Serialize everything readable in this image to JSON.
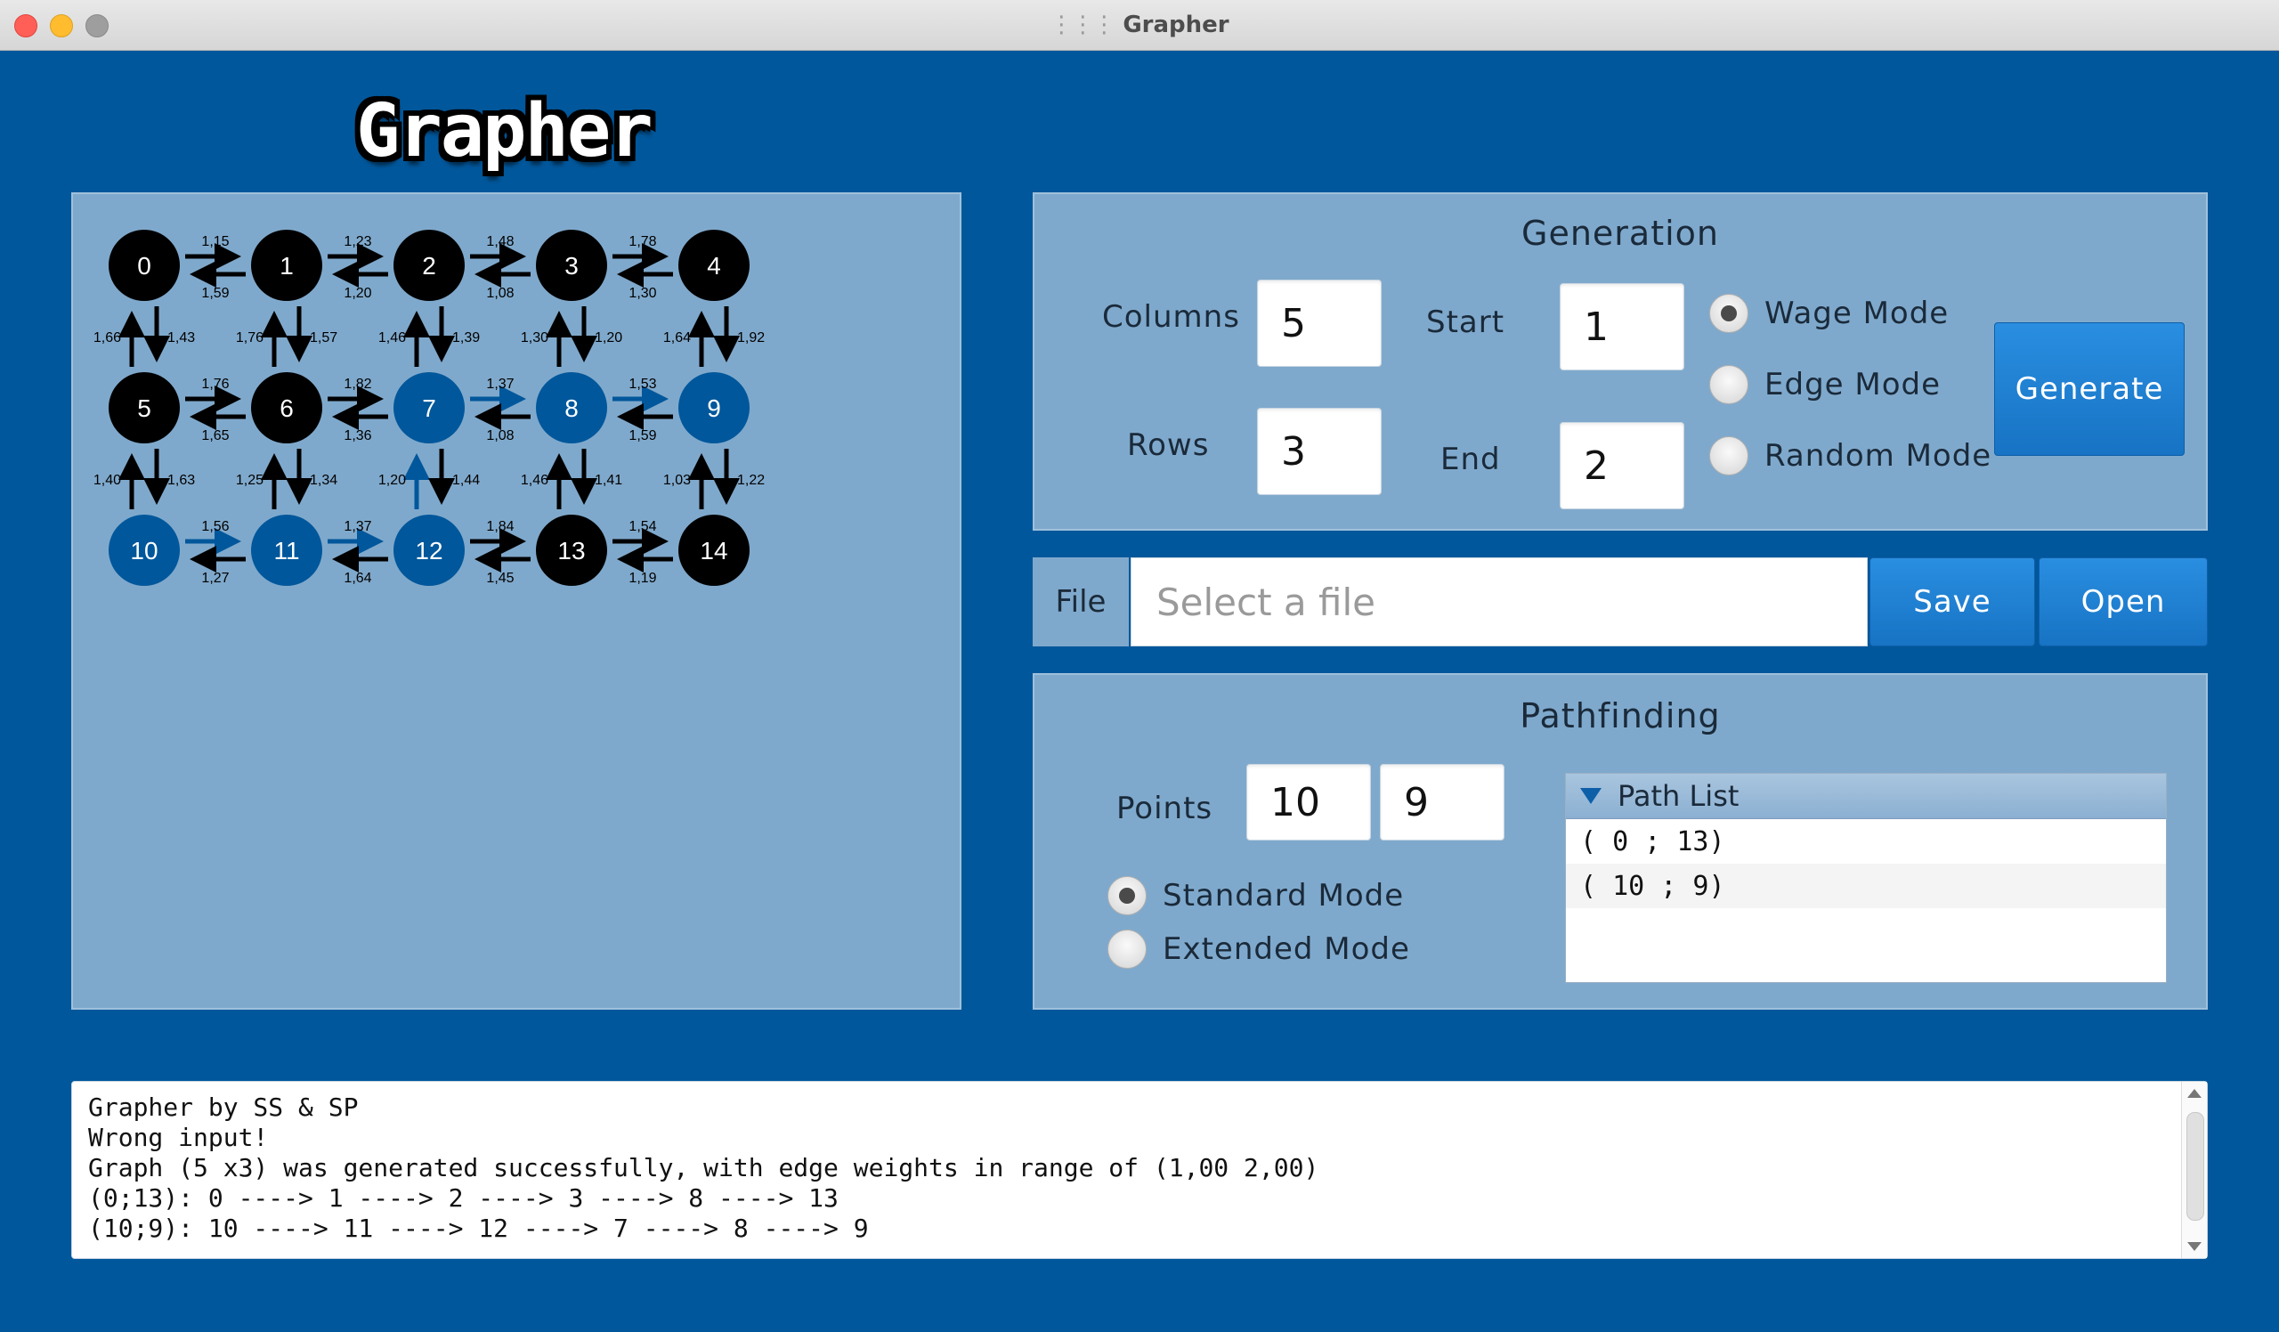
{
  "window": {
    "title": "Grapher"
  },
  "app": {
    "logo_text": "Grapher"
  },
  "graph": {
    "nodes": [
      {
        "id": "0",
        "color": "#000000"
      },
      {
        "id": "1",
        "color": "#000000"
      },
      {
        "id": "2",
        "color": "#000000"
      },
      {
        "id": "3",
        "color": "#000000"
      },
      {
        "id": "4",
        "color": "#000000"
      },
      {
        "id": "5",
        "color": "#000000"
      },
      {
        "id": "6",
        "color": "#000000"
      },
      {
        "id": "7",
        "color": "#01579b"
      },
      {
        "id": "8",
        "color": "#01579b"
      },
      {
        "id": "9",
        "color": "#01579b"
      },
      {
        "id": "10",
        "color": "#01579b"
      },
      {
        "id": "11",
        "color": "#01579b"
      },
      {
        "id": "12",
        "color": "#01579b"
      },
      {
        "id": "13",
        "color": "#000000"
      },
      {
        "id": "14",
        "color": "#000000"
      }
    ],
    "horizontal_edges": [
      {
        "row": 0,
        "col": 0,
        "forward": "1,15",
        "backward": "1,59",
        "forward_highlight": false
      },
      {
        "row": 0,
        "col": 1,
        "forward": "1,23",
        "backward": "1,20",
        "forward_highlight": false
      },
      {
        "row": 0,
        "col": 2,
        "forward": "1,48",
        "backward": "1,08",
        "forward_highlight": false
      },
      {
        "row": 0,
        "col": 3,
        "forward": "1,78",
        "backward": "1,30",
        "forward_highlight": false
      },
      {
        "row": 1,
        "col": 0,
        "forward": "1,76",
        "backward": "1,65",
        "forward_highlight": false
      },
      {
        "row": 1,
        "col": 1,
        "forward": "1,82",
        "backward": "1,36",
        "forward_highlight": false
      },
      {
        "row": 1,
        "col": 2,
        "forward": "1,37",
        "backward": "1,08",
        "forward_highlight": true
      },
      {
        "row": 1,
        "col": 3,
        "forward": "1,53",
        "backward": "1,59",
        "forward_highlight": true
      },
      {
        "row": 2,
        "col": 0,
        "forward": "1,56",
        "backward": "1,27",
        "forward_highlight": true
      },
      {
        "row": 2,
        "col": 1,
        "forward": "1,37",
        "backward": "1,64",
        "forward_highlight": true
      },
      {
        "row": 2,
        "col": 2,
        "forward": "1,84",
        "backward": "1,45",
        "forward_highlight": false
      },
      {
        "row": 2,
        "col": 3,
        "forward": "1,54",
        "backward": "1,19",
        "forward_highlight": false
      }
    ],
    "vertical_edges": [
      {
        "row": 0,
        "col": 0,
        "up": "1,66",
        "down": "1,43",
        "up_highlight": false
      },
      {
        "row": 0,
        "col": 1,
        "up": "1,76",
        "down": "1,57",
        "up_highlight": false
      },
      {
        "row": 0,
        "col": 2,
        "up": "1,46",
        "down": "1,39",
        "up_highlight": false
      },
      {
        "row": 0,
        "col": 3,
        "up": "1,30",
        "down": "1,20",
        "up_highlight": false
      },
      {
        "row": 0,
        "col": 4,
        "up": "1,64",
        "down": "1,92",
        "up_highlight": false
      },
      {
        "row": 1,
        "col": 0,
        "up": "1,40",
        "down": "1,63",
        "up_highlight": false
      },
      {
        "row": 1,
        "col": 1,
        "up": "1,25",
        "down": "1,34",
        "up_highlight": false
      },
      {
        "row": 1,
        "col": 2,
        "up": "1,20",
        "down": "1,44",
        "up_highlight": true
      },
      {
        "row": 1,
        "col": 3,
        "up": "1,46",
        "down": "1,41",
        "up_highlight": false
      },
      {
        "row": 1,
        "col": 4,
        "up": "1,03",
        "down": "1,22",
        "up_highlight": false
      }
    ]
  },
  "generation": {
    "title": "Generation",
    "columns_label": "Columns",
    "columns_value": "5",
    "rows_label": "Rows",
    "rows_value": "3",
    "start_label": "Start",
    "start_value": "1",
    "end_label": "End",
    "end_value": "2",
    "modes": [
      {
        "label": "Wage Mode",
        "selected": true
      },
      {
        "label": "Edge Mode",
        "selected": false
      },
      {
        "label": "Random Mode",
        "selected": false
      }
    ],
    "generate_label": "Generate"
  },
  "file": {
    "label": "File",
    "placeholder": "Select a file",
    "save_label": "Save",
    "open_label": "Open"
  },
  "pathfinding": {
    "title": "Pathfinding",
    "points_label": "Points",
    "point_a": "10",
    "point_b": "9",
    "modes": [
      {
        "label": "Standard Mode",
        "selected": true
      },
      {
        "label": "Extended Mode",
        "selected": false
      }
    ],
    "path_list_title": "Path List",
    "paths": [
      "( 0 ; 13)",
      "( 10 ; 9)"
    ]
  },
  "console": {
    "lines": [
      "Grapher by SS & SP",
      "Wrong input!",
      "Graph (5 x3) was generated successfully, with edge weights in range of (1,00 2,00)",
      "(0;13): 0 ----> 1 ----> 2 ----> 3 ----> 8 ----> 13",
      "(10;9): 10 ----> 11 ----> 12 ----> 7 ----> 8 ----> 9"
    ]
  }
}
